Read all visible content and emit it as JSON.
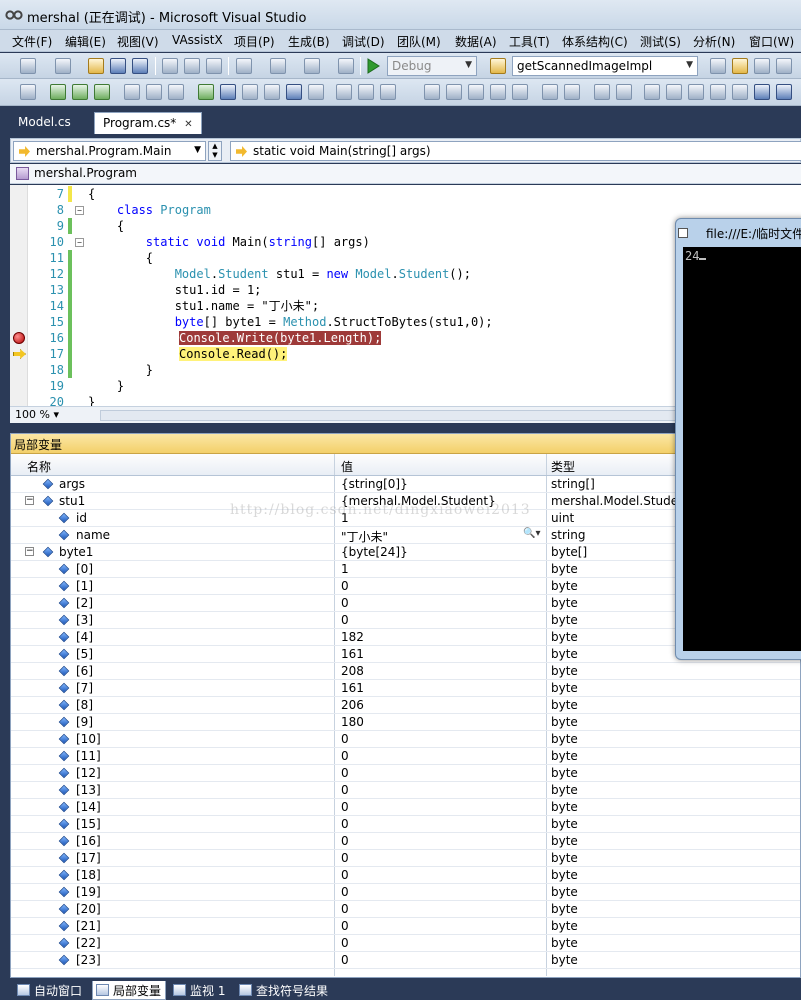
{
  "window": {
    "title": "mershal (正在调试) - Microsoft Visual Studio"
  },
  "menu": [
    "文件(F)",
    "编辑(E)",
    "视图(V)",
    "VAssistX",
    "项目(P)",
    "生成(B)",
    "调试(D)",
    "团队(M)",
    "数据(A)",
    "工具(T)",
    "体系结构(C)",
    "测试(S)",
    "分析(N)",
    "窗口(W)"
  ],
  "toolbar": {
    "config": "Debug",
    "find_combo": "getScannedImageImpl"
  },
  "tabs": [
    {
      "label": "Model.cs"
    },
    {
      "label": "Program.cs*"
    }
  ],
  "nav": {
    "member": "mershal.Program.Main",
    "signature": "static void Main(string[] args)",
    "class": "mershal.Program"
  },
  "editor": {
    "zoom": "100 %",
    "lines": [
      {
        "n": "7",
        "text": "{"
      },
      {
        "n": "8",
        "text": "    class Program"
      },
      {
        "n": "9",
        "text": "    {"
      },
      {
        "n": "10",
        "text": "        static void Main(string[] args)"
      },
      {
        "n": "11",
        "text": "        {"
      },
      {
        "n": "12",
        "text": "            Model.Student stu1 = new Model.Student();"
      },
      {
        "n": "13",
        "text": "            stu1.id = 1;"
      },
      {
        "n": "14",
        "text": "            stu1.name = \"丁小未\";"
      },
      {
        "n": "15",
        "text": "            byte[] byte1 = Method.StructToBytes(stu1,0);"
      },
      {
        "n": "16",
        "text": "Console.Write(byte1.Length);"
      },
      {
        "n": "17",
        "text": "Console.Read();"
      },
      {
        "n": "18",
        "text": "        }"
      },
      {
        "n": "19",
        "text": "    }"
      },
      {
        "n": "20",
        "text": "}"
      }
    ]
  },
  "locals": {
    "title": "局部变量",
    "headers": {
      "name": "名称",
      "value": "值",
      "type": "类型"
    },
    "rows": [
      {
        "name": "args",
        "value": "{string[0]}",
        "type": "string[]"
      },
      {
        "name": "stu1",
        "value": "{mershal.Model.Student}",
        "type": "mershal.Model.Student"
      },
      {
        "name": "id",
        "value": "1",
        "type": "uint"
      },
      {
        "name": "name",
        "value": "\"丁小未\"",
        "type": "string"
      },
      {
        "name": "byte1",
        "value": "{byte[24]}",
        "type": "byte[]"
      },
      {
        "name": "[0]",
        "value": "1",
        "type": "byte"
      },
      {
        "name": "[1]",
        "value": "0",
        "type": "byte"
      },
      {
        "name": "[2]",
        "value": "0",
        "type": "byte"
      },
      {
        "name": "[3]",
        "value": "0",
        "type": "byte"
      },
      {
        "name": "[4]",
        "value": "182",
        "type": "byte"
      },
      {
        "name": "[5]",
        "value": "161",
        "type": "byte"
      },
      {
        "name": "[6]",
        "value": "208",
        "type": "byte"
      },
      {
        "name": "[7]",
        "value": "161",
        "type": "byte"
      },
      {
        "name": "[8]",
        "value": "206",
        "type": "byte"
      },
      {
        "name": "[9]",
        "value": "180",
        "type": "byte"
      },
      {
        "name": "[10]",
        "value": "0",
        "type": "byte"
      },
      {
        "name": "[11]",
        "value": "0",
        "type": "byte"
      },
      {
        "name": "[12]",
        "value": "0",
        "type": "byte"
      },
      {
        "name": "[13]",
        "value": "0",
        "type": "byte"
      },
      {
        "name": "[14]",
        "value": "0",
        "type": "byte"
      },
      {
        "name": "[15]",
        "value": "0",
        "type": "byte"
      },
      {
        "name": "[16]",
        "value": "0",
        "type": "byte"
      },
      {
        "name": "[17]",
        "value": "0",
        "type": "byte"
      },
      {
        "name": "[18]",
        "value": "0",
        "type": "byte"
      },
      {
        "name": "[19]",
        "value": "0",
        "type": "byte"
      },
      {
        "name": "[20]",
        "value": "0",
        "type": "byte"
      },
      {
        "name": "[21]",
        "value": "0",
        "type": "byte"
      },
      {
        "name": "[22]",
        "value": "0",
        "type": "byte"
      },
      {
        "name": "[23]",
        "value": "0",
        "type": "byte"
      }
    ]
  },
  "console": {
    "title": "file:///E:/临时文件",
    "output": "24"
  },
  "bottom_tabs": [
    "自动窗口",
    "局部变量",
    "监视 1",
    "查找符号结果"
  ],
  "watermark": "http://blog.csdn.net/dingxiaowei2013",
  "colors": {
    "frame": "#2b3a57",
    "breakpoint_line": "#9e3a39",
    "current_line": "#fff27a",
    "keyword": "#0000ff",
    "type": "#2b91af"
  }
}
